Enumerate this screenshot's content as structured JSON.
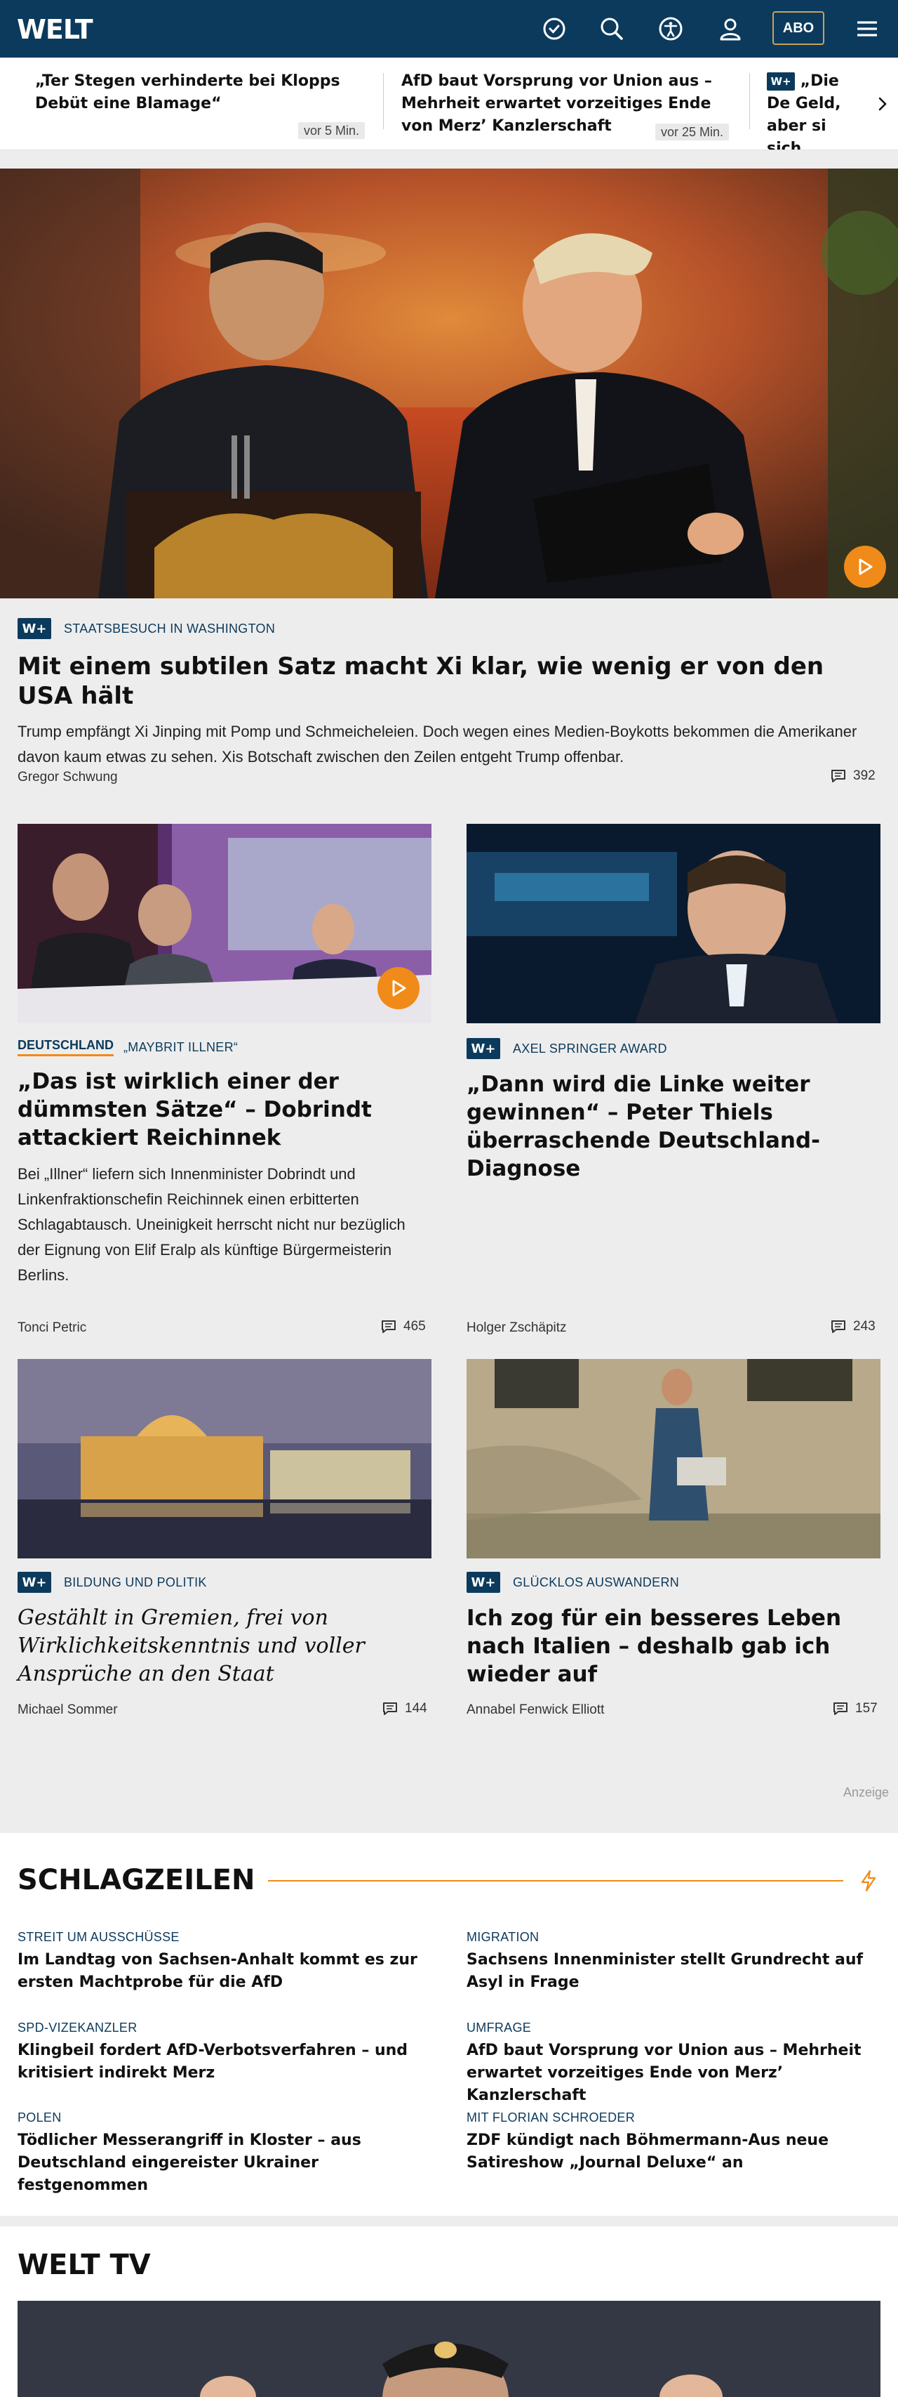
{
  "header": {
    "logo": "WELT",
    "abo_label": "ABO"
  },
  "ticker": [
    {
      "title": "„Ter Stegen verhinderte bei Klopps Debüt eine Blamage“",
      "time": "vor 5 Min."
    },
    {
      "title": "AfD baut Vorsprung vor Union aus – Mehrheit erwartet vorzeitiges Ende von Merz’ Kanzlerschaft",
      "time": "vor 25 Min."
    },
    {
      "title": "„Die De Geld, aber si sich arbeiter",
      "badge": "W+"
    }
  ],
  "badge_label": "W+",
  "hero": {
    "kicker": "STAATSBESUCH IN WASHINGTON",
    "title": "Mit einem subtilen Satz macht Xi klar, wie wenig er von den USA hält",
    "teaser": "Trump empfängt Xi Jinping mit Pomp und Schmeicheleien. Doch wegen eines Medien-Boykotts bekommen die Amerikaner davon kaum etwas zu sehen. Xis Botschaft zwischen den Zeilen entgeht Trump offenbar.",
    "author": "Gregor Schwung",
    "comments": "392"
  },
  "articles": [
    {
      "section": "DEUTSCHLAND",
      "kicker": "„MAYBRIT ILLNER“",
      "title": "„Das ist wirklich einer der dümmsten Sätze“ – Dobrindt attackiert Reichinnek",
      "teaser": "Bei „Illner“ liefern sich Innenminister Dobrindt und Linkenfraktionschefin Reichinnek einen erbitterten Schlagabtausch. Uneinigkeit herrscht nicht nur bezüglich der Eignung von Elif Eralp als künftige Bürgermeisterin Berlins.",
      "author": "Tonci Petric",
      "comments": "465"
    },
    {
      "kicker": "AXEL SPRINGER AWARD",
      "title": "„Dann wird die Linke weiter gewinnen“ – Peter Thiels überraschende Deutschland-Diagnose",
      "author": "Holger Zschäpitz",
      "comments": "243"
    },
    {
      "kicker": "BILDUNG UND POLITIK",
      "title": "Gestählt in Gremien, frei von Wirklichkeitskenntnis und voller Ansprüche an den Staat",
      "author": "Michael Sommer",
      "comments": "144"
    },
    {
      "kicker": "GLÜCKLOS AUSWANDERN",
      "title": "Ich zog für ein besseres Leben nach Italien – deshalb gab ich wieder auf",
      "author": "Annabel Fenwick Elliott",
      "comments": "157"
    }
  ],
  "ad_label": "Anzeige",
  "schlagzeilen": {
    "title": "SCHLAGZEILEN",
    "items": [
      {
        "kicker": "STREIT UM AUSSCHÜSSE",
        "title": "Im Landtag von Sachsen-Anhalt kommt es zur ersten Machtprobe für die AfD"
      },
      {
        "kicker": "MIGRATION",
        "title": "Sachsens Innenminister stellt Grundrecht auf Asyl in Frage"
      },
      {
        "kicker": "SPD-VIZEKANZLER",
        "title": "Klingbeil fordert AfD-Verbotsverfahren – und kritisiert indirekt Merz"
      },
      {
        "kicker": "UMFRAGE",
        "title": "AfD baut Vorsprung vor Union aus – Mehrheit erwartet vorzeitiges Ende von Merz’ Kanzlerschaft"
      },
      {
        "kicker": "POLEN",
        "title": "Tödlicher Messerangriff in Kloster – aus Deutschland eingereister Ukrainer festgenommen"
      },
      {
        "kicker": "MIT FLORIAN SCHROEDER",
        "title": "ZDF kündigt nach Böhmermann-Aus neue Satireshow „Journal Deluxe“ an"
      }
    ]
  },
  "welttv": {
    "title": "WELT TV"
  },
  "colors": {
    "brand": "#0c3a5c",
    "accent": "#f08a19",
    "gold": "#c7a35a"
  }
}
